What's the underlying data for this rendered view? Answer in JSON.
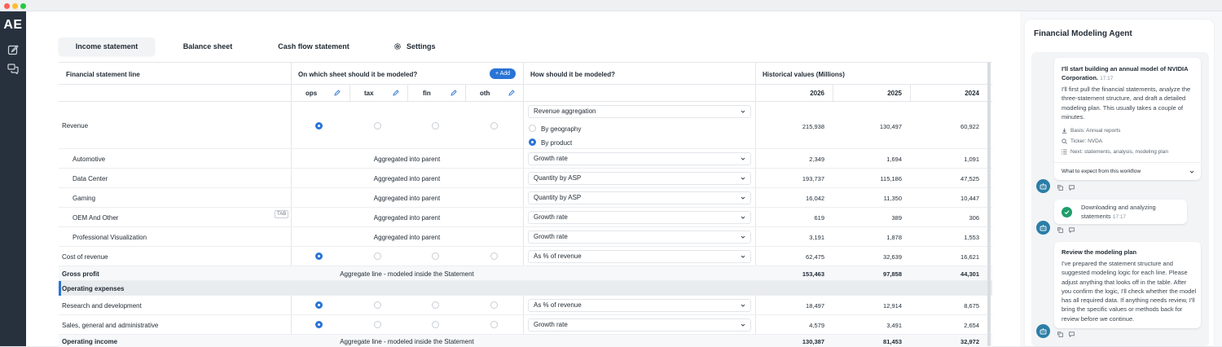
{
  "app": {
    "logo": "AE"
  },
  "tabs": [
    {
      "label": "Income statement",
      "active": true
    },
    {
      "label": "Balance sheet",
      "active": false
    },
    {
      "label": "Cash flow statement",
      "active": false
    },
    {
      "label": "Settings",
      "active": false,
      "icon": "gear-icon"
    }
  ],
  "table": {
    "col_line": "Financial statement line",
    "col_sheet": "On which sheet should it be modeled?",
    "add_label": "+ Add",
    "col_how": "How should it be modeled?",
    "col_hist": "Historical values (Millions)",
    "sheets": [
      "ops",
      "tax",
      "fin",
      "oth"
    ],
    "years": [
      "2026",
      "2025",
      "2024"
    ],
    "tab_badge": "TAB",
    "aggregated_label": "Aggregated into parent",
    "aggregate_line_label": "Aggregate line - modeled inside the Statement",
    "revenue": {
      "label": "Revenue",
      "method": "Revenue aggregation",
      "options": [
        "By geography",
        "By product"
      ],
      "selected_option": "By product",
      "values": [
        "215,938",
        "130,497",
        "60,922"
      ]
    },
    "children": [
      {
        "label": "Automotive",
        "method": "Growth rate",
        "values": [
          "2,349",
          "1,694",
          "1,091"
        ]
      },
      {
        "label": "Data Center",
        "method": "Quantity by ASP",
        "values": [
          "193,737",
          "115,186",
          "47,525"
        ]
      },
      {
        "label": "Gaming",
        "method": "Quantity by ASP",
        "values": [
          "16,042",
          "11,350",
          "10,447"
        ]
      },
      {
        "label": "OEM And Other",
        "method": "Growth rate",
        "values": [
          "619",
          "389",
          "306"
        ]
      },
      {
        "label": "Professional Visualization",
        "method": "Growth rate",
        "values": [
          "3,191",
          "1,878",
          "1,553"
        ]
      }
    ],
    "cost_of_revenue": {
      "label": "Cost of revenue",
      "method": "As % of revenue",
      "values": [
        "62,475",
        "32,639",
        "16,621"
      ]
    },
    "gross_profit": {
      "label": "Gross profit",
      "values": [
        "153,463",
        "97,858",
        "44,301"
      ]
    },
    "opex_section": "Operating expenses",
    "rnd": {
      "label": "Research and development",
      "method": "As % of revenue",
      "values": [
        "18,497",
        "12,914",
        "8,675"
      ]
    },
    "sga": {
      "label": "Sales, general and administrative",
      "method": "Growth rate",
      "values": [
        "4,579",
        "3,491",
        "2,654"
      ]
    },
    "operating_income": {
      "label": "Operating income",
      "values": [
        "130,387",
        "81,453",
        "32,972"
      ]
    }
  },
  "agent": {
    "title": "Financial Modeling Agent",
    "msg1": {
      "title": "I'll start building an annual model of NVIDIA Corporation.",
      "time": "17:17",
      "text": "I'll first pull the financial statements, analyze the three-statement structure, and draft a detailed modeling plan. This usually takes a couple of minutes.",
      "basis": "Basis: Annual reports",
      "ticker": "Ticker: NVDA",
      "next": "Next: statements, analysis, modeling plan",
      "expect": "What to expect from this workflow"
    },
    "msg2": {
      "text": "Downloading and analyzing statements",
      "time": "17:17"
    },
    "msg3": {
      "title": "Review the modeling plan",
      "text": "I've prepared the statement structure and suggested modeling logic for each line. Please adjust anything that looks off in the table. After you confirm the logic, I'll check whether the model has all required data. If anything needs review, I'll bring the specific values or methods back for review before we continue."
    },
    "colors": {
      "bot": "#2b7ea6",
      "success": "#1f9d6b",
      "accent": "#2a74d6"
    }
  }
}
